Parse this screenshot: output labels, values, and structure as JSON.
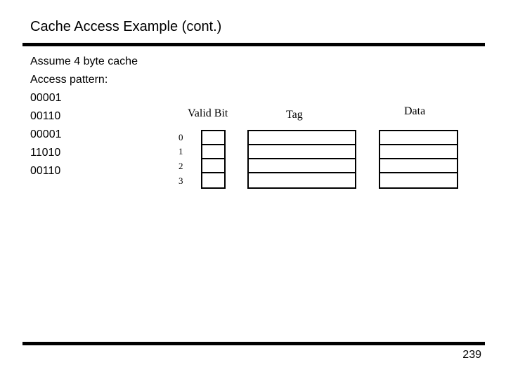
{
  "slide": {
    "title": "Cache Access Example (cont.)",
    "body_lines": [
      "Assume 4 byte cache",
      "Access pattern:",
      "00001",
      "00110",
      "00001",
      "11010",
      "00110"
    ],
    "page_number": "239"
  },
  "cache_table": {
    "headers": {
      "valid": "Valid Bit",
      "tag": "Tag",
      "data": "Data"
    },
    "indices": [
      "0",
      "1",
      "2",
      "3"
    ],
    "rows": [
      {
        "valid": "",
        "tag": "",
        "data": ""
      },
      {
        "valid": "",
        "tag": "",
        "data": ""
      },
      {
        "valid": "",
        "tag": "",
        "data": ""
      },
      {
        "valid": "",
        "tag": "",
        "data": ""
      }
    ]
  }
}
